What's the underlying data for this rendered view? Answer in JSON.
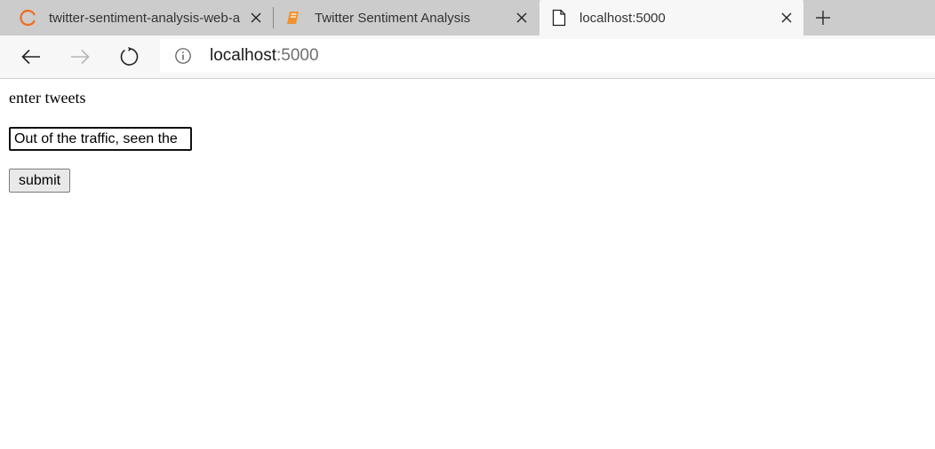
{
  "browser": {
    "tabs": [
      {
        "title": "twitter-sentiment-analysis-web-a",
        "icon": "loading-spinner-icon",
        "active": false
      },
      {
        "title": "Twitter Sentiment Analysis",
        "icon": "notebook-icon",
        "active": false
      },
      {
        "title": "localhost:5000",
        "icon": "page-icon",
        "active": true
      }
    ],
    "address": {
      "host": "localhost",
      "port": ":5000"
    },
    "colors": {
      "tabstrip": "#cccccc",
      "toolbar": "#f7f7f7",
      "spinner": "#f26b21",
      "notebook": "#f0922f"
    }
  },
  "page": {
    "prompt_label": "enter tweets",
    "tweet_input_value": "Out of the traffic, seen the",
    "submit_label": "submit"
  }
}
